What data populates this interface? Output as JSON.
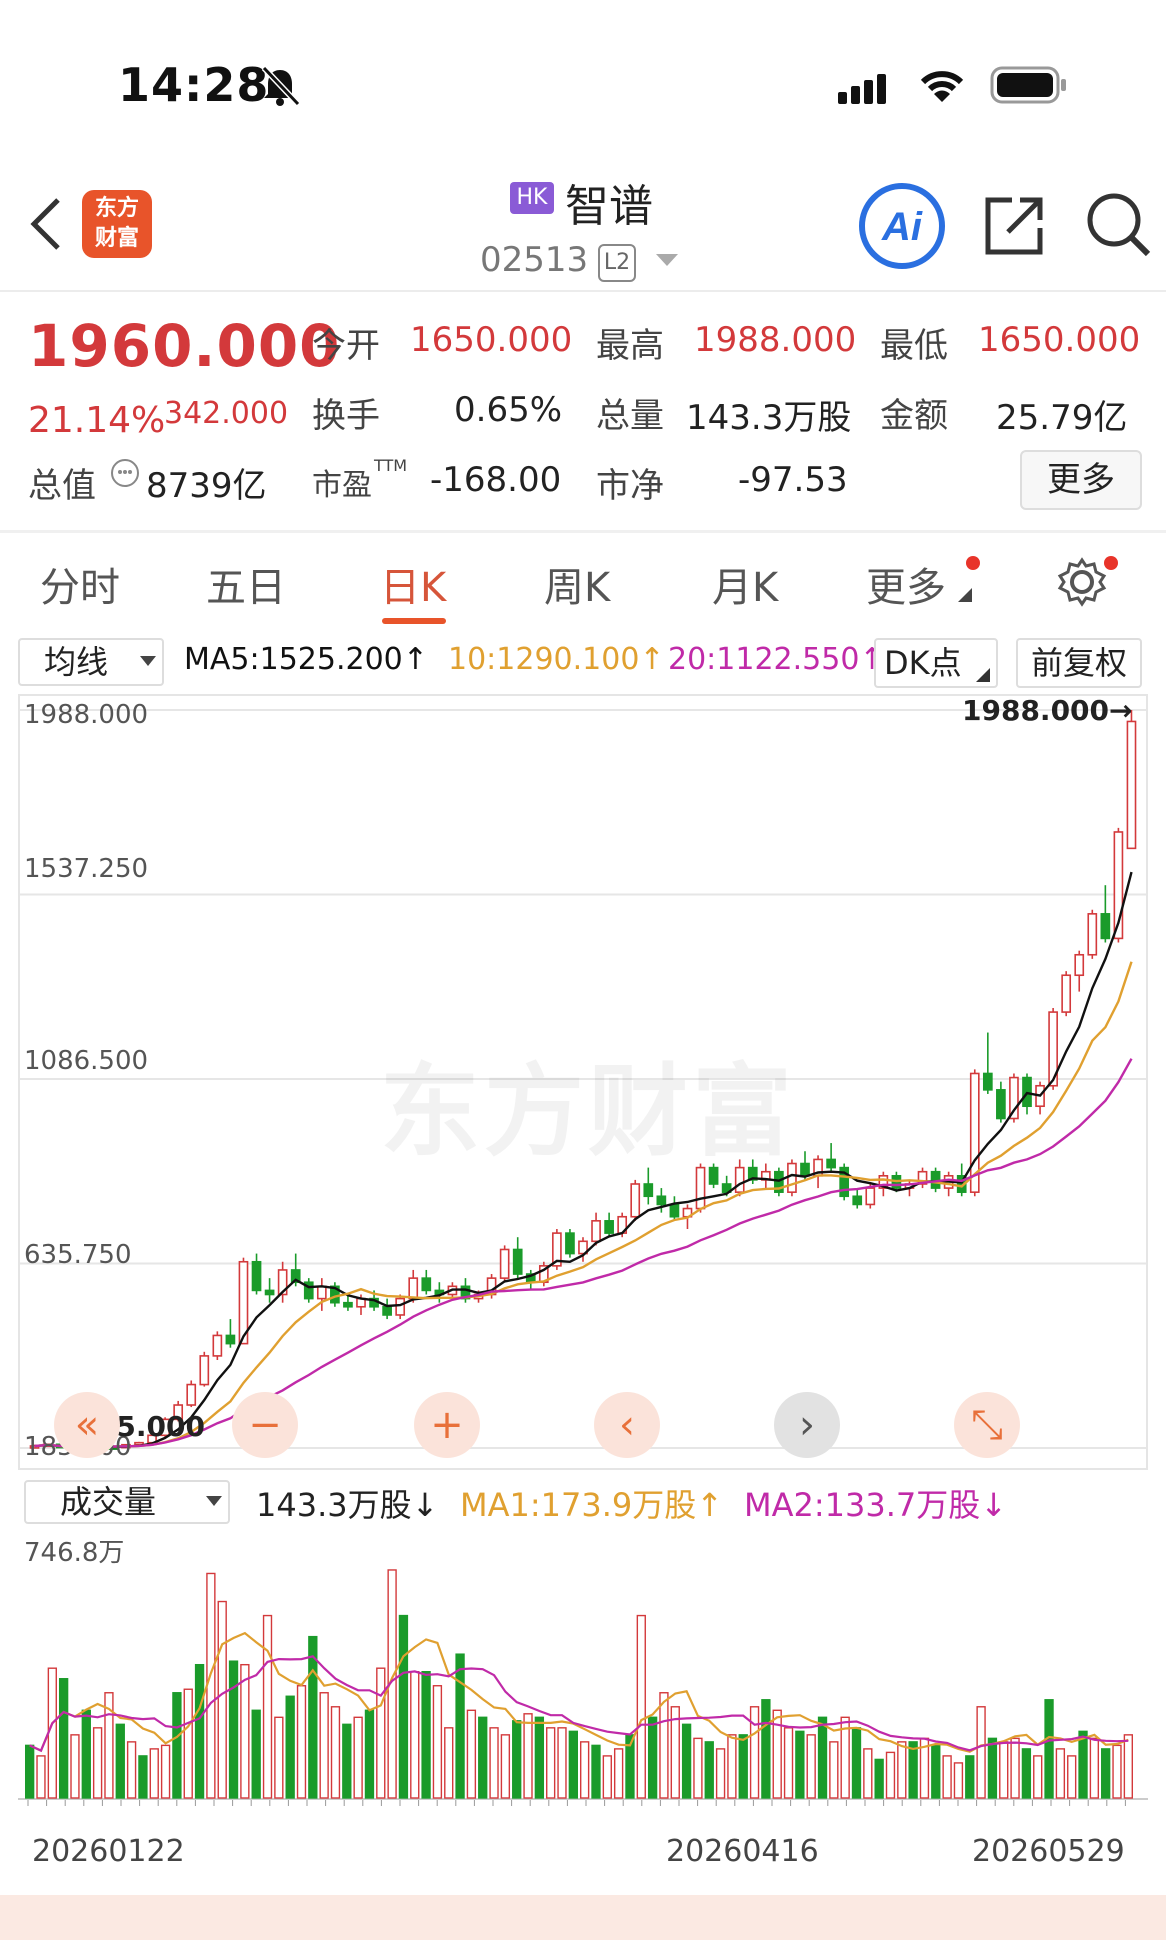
{
  "status": {
    "time": "14:28"
  },
  "header": {
    "logo_text": "东方\n财富",
    "market": "HK",
    "name": "智谱",
    "code": "02513",
    "level": "L2"
  },
  "quote": {
    "last": "1960.000",
    "change_pct": "21.14%",
    "change": "342.000",
    "open_label": "今开",
    "open": "1650.000",
    "high_label": "最高",
    "high": "1988.000",
    "low_label": "最低",
    "low": "1650.000",
    "turnover_label": "换手",
    "turnover": "0.65%",
    "volume_label": "总量",
    "volume": "143.3万股",
    "amount_label": "金额",
    "amount": "25.79亿",
    "mcap_label": "总值",
    "mcap": "8739亿",
    "pe_label": "市盈",
    "pe_sup": "TTM",
    "pe": "-168.00",
    "pb_label": "市净",
    "pb": "-97.53",
    "more": "更多"
  },
  "tabs": [
    "分时",
    "五日",
    "日K",
    "周K",
    "月K",
    "更多"
  ],
  "ma_bar": {
    "select": "均线",
    "ma5": "MA5:1525.200↑",
    "ma10": "10:1290.100↑",
    "ma20": "20:1122.550↑",
    "dk": "DK点",
    "adjust": "前复权"
  },
  "colors": {
    "up": "#d3393b",
    "down": "#1a9b2a",
    "ma5": "#111111",
    "ma10": "#e0a030",
    "ma20": "#c02aa8",
    "accent": "#e8542a"
  },
  "watermark": "东方财富",
  "chart_data": {
    "type": "candlestick",
    "y_ticks": [
      "1988.000",
      "1537.250",
      "1086.500",
      "635.750",
      "185.000"
    ],
    "ylim": [
      185,
      1988
    ],
    "max_label": "1988.000→",
    "min_label": "←185.000",
    "x_ticks": [
      "20260122",
      "20260416",
      "20260529"
    ],
    "last_close": 1960,
    "ma5_last": 1525.2,
    "ma10_last": 1290.1,
    "ma20_last": 1122.55,
    "candles": [
      [
        190,
        193,
        186,
        190
      ],
      [
        190,
        196,
        188,
        194
      ],
      [
        194,
        195,
        185,
        186
      ],
      [
        186,
        190,
        185,
        189
      ],
      [
        189,
        192,
        187,
        188
      ],
      [
        188,
        191,
        186,
        187
      ],
      [
        187,
        190,
        185,
        186
      ],
      [
        186,
        194,
        186,
        193
      ],
      [
        193,
        200,
        190,
        198
      ],
      [
        198,
        220,
        196,
        216
      ],
      [
        216,
        260,
        212,
        255
      ],
      [
        255,
        300,
        250,
        290
      ],
      [
        290,
        350,
        285,
        340
      ],
      [
        340,
        420,
        335,
        410
      ],
      [
        410,
        470,
        400,
        460
      ],
      [
        460,
        500,
        430,
        440
      ],
      [
        440,
        650,
        440,
        640
      ],
      [
        640,
        660,
        560,
        570
      ],
      [
        570,
        600,
        540,
        560
      ],
      [
        560,
        640,
        540,
        620
      ],
      [
        620,
        660,
        580,
        590
      ],
      [
        590,
        600,
        540,
        550
      ],
      [
        550,
        600,
        520,
        580
      ],
      [
        580,
        590,
        530,
        540
      ],
      [
        540,
        560,
        520,
        530
      ],
      [
        530,
        560,
        510,
        550
      ],
      [
        550,
        570,
        520,
        530
      ],
      [
        530,
        550,
        500,
        510
      ],
      [
        510,
        560,
        500,
        550
      ],
      [
        550,
        620,
        540,
        600
      ],
      [
        600,
        620,
        560,
        570
      ],
      [
        570,
        590,
        540,
        560
      ],
      [
        560,
        590,
        550,
        580
      ],
      [
        580,
        600,
        540,
        550
      ],
      [
        550,
        570,
        540,
        560
      ],
      [
        560,
        610,
        550,
        600
      ],
      [
        600,
        680,
        590,
        670
      ],
      [
        670,
        700,
        600,
        610
      ],
      [
        610,
        620,
        570,
        590
      ],
      [
        590,
        640,
        580,
        630
      ],
      [
        630,
        720,
        620,
        710
      ],
      [
        710,
        720,
        650,
        660
      ],
      [
        660,
        700,
        640,
        690
      ],
      [
        690,
        760,
        680,
        740
      ],
      [
        740,
        760,
        700,
        710
      ],
      [
        710,
        760,
        700,
        750
      ],
      [
        750,
        840,
        740,
        830
      ],
      [
        830,
        870,
        780,
        800
      ],
      [
        800,
        820,
        760,
        780
      ],
      [
        780,
        800,
        740,
        750
      ],
      [
        750,
        780,
        720,
        770
      ],
      [
        770,
        880,
        760,
        870
      ],
      [
        870,
        880,
        820,
        830
      ],
      [
        830,
        850,
        800,
        810
      ],
      [
        810,
        890,
        800,
        870
      ],
      [
        870,
        890,
        830,
        840
      ],
      [
        840,
        880,
        820,
        860
      ],
      [
        860,
        870,
        800,
        810
      ],
      [
        810,
        890,
        800,
        880
      ],
      [
        880,
        910,
        840,
        850
      ],
      [
        850,
        900,
        820,
        890
      ],
      [
        890,
        930,
        860,
        870
      ],
      [
        870,
        880,
        790,
        800
      ],
      [
        800,
        820,
        770,
        780
      ],
      [
        780,
        830,
        770,
        820
      ],
      [
        820,
        860,
        800,
        850
      ],
      [
        850,
        860,
        810,
        820
      ],
      [
        820,
        840,
        800,
        830
      ],
      [
        830,
        870,
        820,
        860
      ],
      [
        860,
        870,
        810,
        820
      ],
      [
        820,
        860,
        800,
        850
      ],
      [
        850,
        880,
        800,
        810
      ],
      [
        810,
        1110,
        800,
        1100
      ],
      [
        1100,
        1200,
        1050,
        1060
      ],
      [
        1060,
        1080,
        980,
        990
      ],
      [
        990,
        1100,
        980,
        1090
      ],
      [
        1090,
        1100,
        1000,
        1020
      ],
      [
        1020,
        1080,
        1000,
        1070
      ],
      [
        1070,
        1260,
        1060,
        1250
      ],
      [
        1250,
        1350,
        1240,
        1340
      ],
      [
        1340,
        1400,
        1300,
        1390
      ],
      [
        1390,
        1500,
        1380,
        1490
      ],
      [
        1490,
        1560,
        1420,
        1430
      ],
      [
        1430,
        1700,
        1420,
        1690
      ],
      [
        1650,
        1988,
        1650,
        1960
      ]
    ],
    "volume": {
      "select": "成交量",
      "current": "143.3万股↓",
      "ma1": "MA1:173.9万股↑",
      "ma2": "MA2:133.7万股↓",
      "y_max_label": "746.8万",
      "values": [
        150,
        120,
        370,
        340,
        180,
        250,
        200,
        300,
        210,
        160,
        120,
        140,
        150,
        300,
        310,
        380,
        640,
        560,
        390,
        380,
        250,
        520,
        230,
        290,
        320,
        460,
        300,
        260,
        210,
        230,
        250,
        370,
        650,
        520,
        360,
        360,
        320,
        200,
        410,
        250,
        230,
        200,
        180,
        220,
        240,
        230,
        200,
        200,
        190,
        160,
        150,
        120,
        140,
        180,
        520,
        230,
        300,
        260,
        210,
        170,
        160,
        140,
        180,
        180,
        260,
        280,
        250,
        200,
        190,
        180,
        230,
        160,
        230,
        200,
        140,
        110,
        130,
        160,
        160,
        170,
        150,
        120,
        100,
        120,
        260,
        170,
        160,
        170,
        140,
        120,
        280,
        140,
        120,
        190,
        170,
        140,
        150,
        180
      ]
    }
  }
}
